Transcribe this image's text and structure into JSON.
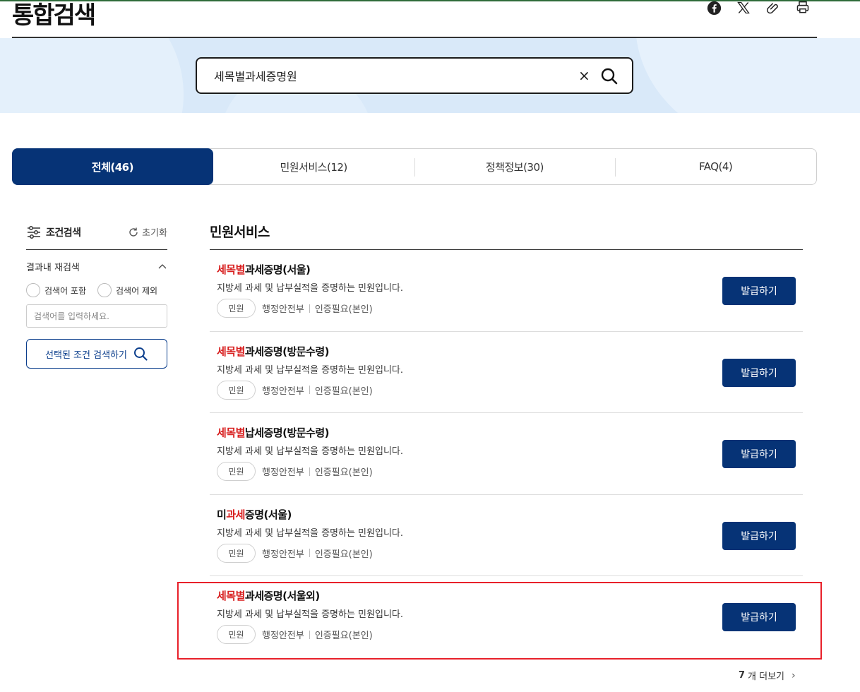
{
  "page": {
    "title": "통합검색"
  },
  "share": {
    "icons": [
      "facebook-icon",
      "x-icon",
      "attachment-icon",
      "print-icon"
    ]
  },
  "search": {
    "value": "세목별과세증명원",
    "clear_label": "×"
  },
  "tabs": [
    {
      "label": "전체(46)",
      "active": true
    },
    {
      "label": "민원서비스(12)",
      "active": false
    },
    {
      "label": "정책정보(30)",
      "active": false
    },
    {
      "label": "FAQ(4)",
      "active": false
    }
  ],
  "sidebar": {
    "title": "조건검색",
    "reset_label": "초기화",
    "refine_label": "결과내 재검색",
    "radio_include": "검색어 포함",
    "radio_exclude": "검색어 제외",
    "input_placeholder": "검색어를 입력하세요.",
    "search_button": "선택된 조건 검색하기"
  },
  "section": {
    "title": "민원서비스"
  },
  "results": [
    {
      "title_hl": "세목별",
      "title_hl2": "",
      "title_pre": "",
      "title_rest": "과세증명(서울)",
      "desc": "지방세 과세 및 납부실적을 증명하는 민원입니다.",
      "badge": "민원",
      "agency": "행정안전부",
      "auth": "인증필요(본인)",
      "button": "발급하기"
    },
    {
      "title_hl": "세목별",
      "title_hl2": "",
      "title_pre": "",
      "title_rest": "과세증명(방문수령)",
      "desc": "지방세 과세 및 납부실적을 증명하는 민원입니다.",
      "badge": "민원",
      "agency": "행정안전부",
      "auth": "인증필요(본인)",
      "button": "발급하기"
    },
    {
      "title_hl": "세목별",
      "title_hl2": "",
      "title_pre": "",
      "title_rest": "납세증명(방문수령)",
      "desc": "지방세 과세 및 납부실적을 증명하는 민원입니다.",
      "badge": "민원",
      "agency": "행정안전부",
      "auth": "인증필요(본인)",
      "button": "발급하기"
    },
    {
      "title_hl": "",
      "title_pre": "미",
      "title_hl2": "과세",
      "title_rest": "증명(서울)",
      "desc": "지방세 과세 및 납부실적을 증명하는 민원입니다.",
      "badge": "민원",
      "agency": "행정안전부",
      "auth": "인증필요(본인)",
      "button": "발급하기"
    },
    {
      "title_hl": "세목별",
      "title_hl2": "",
      "title_pre": "",
      "title_rest": "과세증명(서울외)",
      "desc": "지방세 과세 및 납부실적을 증명하는 민원입니다.",
      "badge": "민원",
      "agency": "행정안전부",
      "auth": "인증필요(본인)",
      "button": "발급하기"
    }
  ],
  "more": {
    "count": "7",
    "label": "개 더보기"
  },
  "colors": {
    "primary": "#063376",
    "highlight_text": "#d81f1f",
    "annotation_box": "#e8202a",
    "band": "#d9e9f9"
  }
}
